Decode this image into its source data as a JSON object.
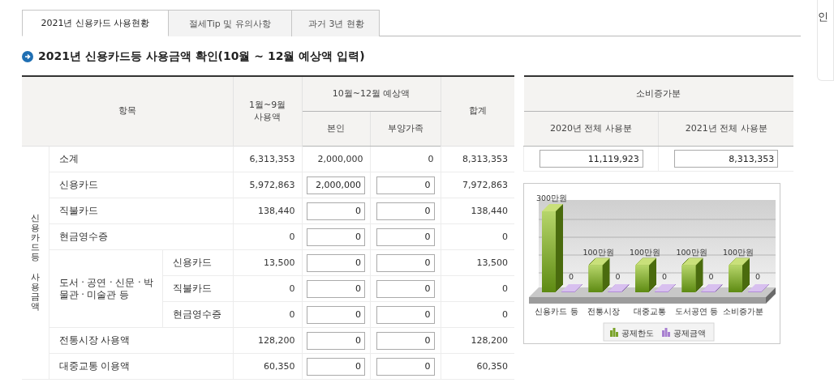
{
  "tabs": [
    {
      "label": "2021년 신용카드 사용현황",
      "selected": true
    },
    {
      "label": "절세Tip 및 유의사항",
      "selected": false
    },
    {
      "label": "과거 3년 현황",
      "selected": false
    }
  ],
  "section_title": "2021년 신용카드등 사용금액 확인(10월 ~ 12월 예상액 입력)",
  "usage_table": {
    "columns": {
      "item": "항목",
      "jan_sep": "1월~9월\n사용액",
      "forecast": "10월~12월 예상액",
      "self": "본인",
      "dependents": "부양가족",
      "total": "합계"
    },
    "group_label": "신용카드등 사용금액",
    "rows": [
      {
        "label": "소계",
        "kind": "subtotal",
        "jan_sep": "6,313,353",
        "self": "2,000,000",
        "dependents": "0",
        "total": "8,313,353"
      },
      {
        "label": "신용카드",
        "kind": "input",
        "jan_sep": "5,972,863",
        "self": "2,000,000",
        "dependents": "0",
        "total": "7,972,863"
      },
      {
        "label": "직불카드",
        "kind": "input",
        "jan_sep": "138,440",
        "self": "0",
        "dependents": "0",
        "total": "138,440"
      },
      {
        "label": "현금영수증",
        "kind": "input",
        "jan_sep": "0",
        "self": "0",
        "dependents": "0",
        "total": "0"
      },
      {
        "label": "도서 · 공연 · 신문 · 박물관 · 미술관 등",
        "kind": "group",
        "children": [
          {
            "label": "신용카드",
            "kind": "input",
            "jan_sep": "13,500",
            "self": "0",
            "dependents": "0",
            "total": "13,500"
          },
          {
            "label": "직불카드",
            "kind": "input",
            "jan_sep": "0",
            "self": "0",
            "dependents": "0",
            "total": "0"
          },
          {
            "label": "현금영수증",
            "kind": "input",
            "jan_sep": "0",
            "self": "0",
            "dependents": "0",
            "total": "0"
          }
        ]
      },
      {
        "label": "전통시장 사용액",
        "kind": "input",
        "jan_sep": "128,200",
        "self": "0",
        "dependents": "0",
        "total": "128,200"
      },
      {
        "label": "대중교통 이용액",
        "kind": "input",
        "jan_sep": "60,350",
        "self": "0",
        "dependents": "0",
        "total": "60,350"
      }
    ]
  },
  "increase_table": {
    "title": "소비증가분",
    "columns": [
      "2020년 전체 사용분",
      "2021년 전체 사용분"
    ],
    "values": [
      "11,119,923",
      "8,313,353"
    ]
  },
  "chart_data": {
    "type": "bar",
    "categories": [
      "신용카드 등",
      "전통시장",
      "대중교통",
      "도서공연 등",
      "소비증가분"
    ],
    "series": [
      {
        "name": "공제한도",
        "color": "#7aa32a",
        "values": [
          300,
          100,
          100,
          100,
          100
        ],
        "value_labels": [
          "300만원",
          "100만원",
          "100만원",
          "100만원",
          "100만원"
        ]
      },
      {
        "name": "공제금액",
        "color": "#a77fd0",
        "values": [
          0,
          0,
          0,
          0,
          0
        ],
        "value_labels": [
          "0",
          "0",
          "0",
          "0",
          "0"
        ]
      }
    ],
    "data_labels": true,
    "legend": true
  },
  "side_panel": {
    "label": "인"
  }
}
